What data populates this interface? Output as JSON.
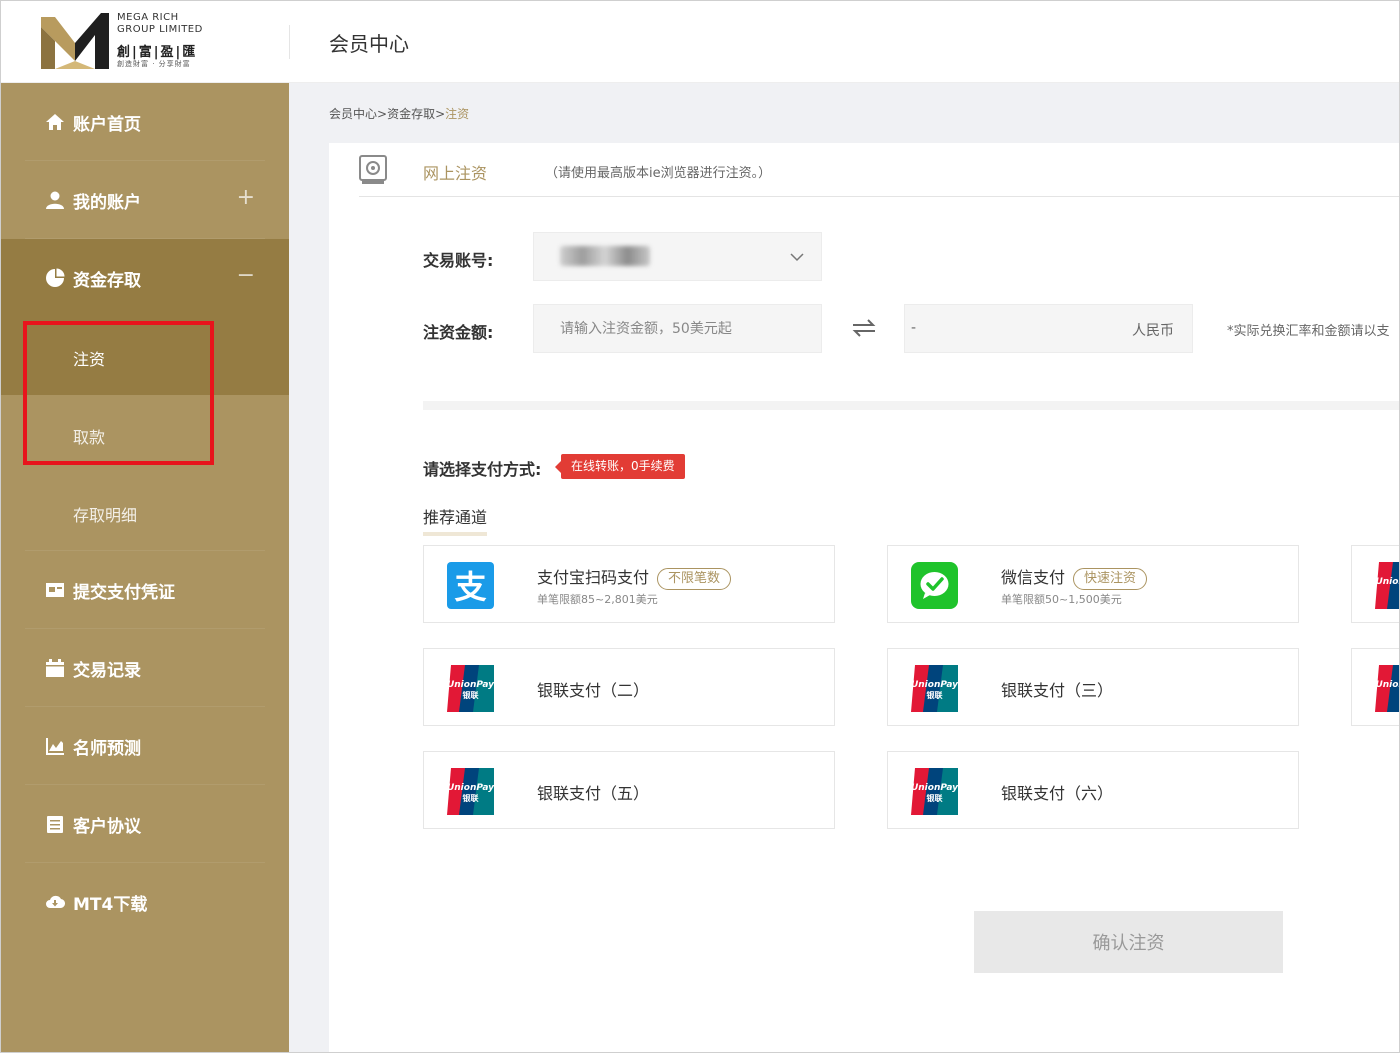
{
  "brand": {
    "line1": "MEGA RICH",
    "line2": "GROUP LIMITED",
    "cn_name": "創|富|盈|匯",
    "slogan": "創造財富 · 分享財富"
  },
  "header": {
    "title": "会员中心"
  },
  "sidebar": {
    "items": [
      {
        "label": "账户首页",
        "icon": "home-icon"
      },
      {
        "label": "我的账户",
        "icon": "user-icon",
        "toggle": "+"
      },
      {
        "label": "资金存取",
        "icon": "pie-icon",
        "toggle": "−"
      },
      {
        "label": "提交支付凭证",
        "icon": "card-icon"
      },
      {
        "label": "交易记录",
        "icon": "calendar-icon"
      },
      {
        "label": "名师预测",
        "icon": "chart-icon"
      },
      {
        "label": "客户协议",
        "icon": "document-icon"
      },
      {
        "label": "MT4下载",
        "icon": "cloud-download-icon"
      }
    ],
    "sub_items": [
      "注资",
      "取款",
      "存取明细"
    ]
  },
  "breadcrumb": {
    "part1": "会员中心",
    "sep": ">",
    "part2": "资金存取",
    "current": "注资"
  },
  "panel": {
    "title": "网上注资",
    "note": "（请使用最高版本ie浏览器进行注资。）"
  },
  "form": {
    "account_label": "交易账号:",
    "amount_label": "注资金额:",
    "amount_placeholder": "请输入注资金额，50美元起",
    "rmb_value": "-",
    "rmb_unit": "人民币",
    "rate_note": "*实际兑换汇率和金额请以支"
  },
  "payment": {
    "label": "请选择支付方式:",
    "promo": "在线转账，0手续费",
    "channel_title": "推荐通道",
    "methods": [
      {
        "name": "支付宝扫码支付",
        "tag": "不限笔数",
        "limit": "单笔限额85~2,801美元",
        "icon": "alipay-icon"
      },
      {
        "name": "微信支付",
        "tag": "快速注资",
        "limit": "单笔限额50~1,500美元",
        "icon": "wechat-icon"
      },
      {
        "name": "银联支付（二）",
        "icon": "unionpay-icon"
      },
      {
        "name": "银联支付（三）",
        "icon": "unionpay-icon"
      },
      {
        "name": "银联支付（五）",
        "icon": "unionpay-icon"
      },
      {
        "name": "银联支付（六）",
        "icon": "unionpay-icon"
      }
    ]
  },
  "confirm_label": "确认注资",
  "colors": {
    "sidebar": "#ab9461",
    "sidebar_active": "#957c43",
    "accent": "#ab9461",
    "promo": "#e23c35",
    "highlight": "#e8141c"
  }
}
